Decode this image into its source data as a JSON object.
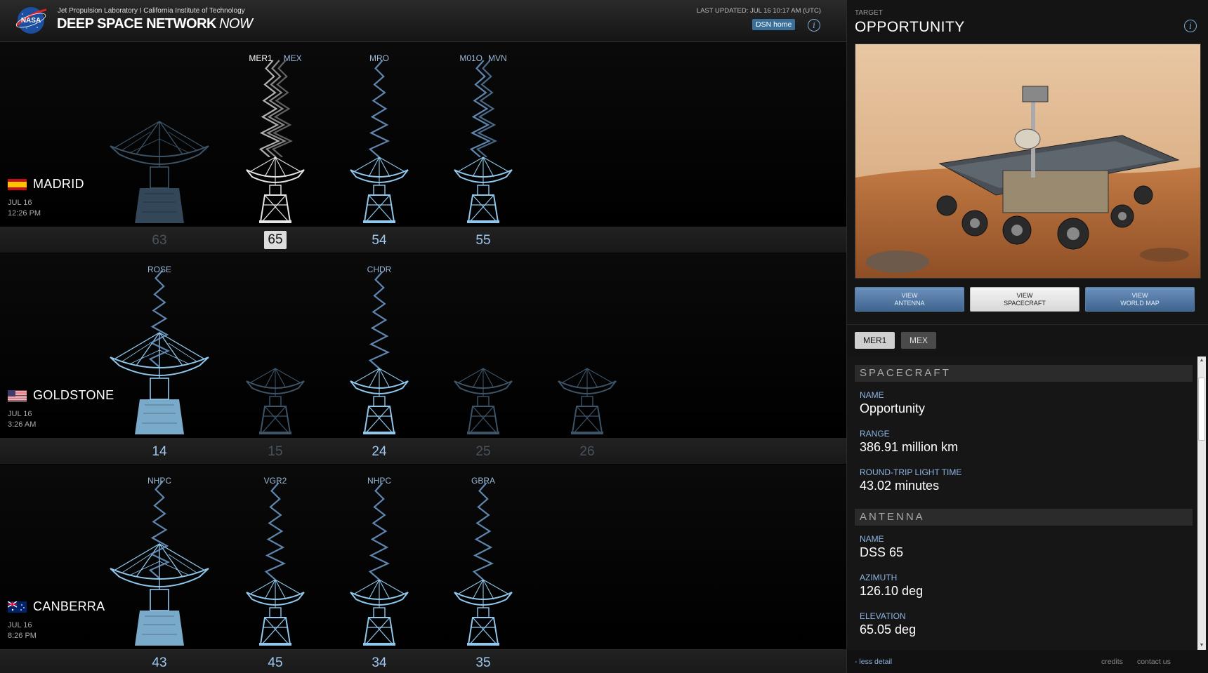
{
  "header": {
    "org_line": "Jet Propulsion Laboratory I California Institute of Technology",
    "title_main": "DEEP SPACE NETWORK",
    "title_now": "NOW",
    "last_updated": "LAST UPDATED: JUL 16 10:17 AM (UTC)",
    "dsn_home": "DSN home",
    "info_glyph": "i"
  },
  "colors": {
    "accent_blue": "#9ec8f0",
    "dish_blue": "#8fc8ec",
    "dish_dim": "#3c5468",
    "dish_white": "#e6e6e6"
  },
  "complexes": [
    {
      "name": "MADRID",
      "date": "JUL 16",
      "time": "12:26 PM",
      "flag": "spain-flag-icon",
      "dishes": [
        {
          "number": "63",
          "state": "dim",
          "size": "large",
          "targets": []
        },
        {
          "number": "65",
          "state": "selected",
          "size": "small",
          "targets": [
            "MER1",
            "MEX"
          ]
        },
        {
          "number": "54",
          "state": "active",
          "size": "small",
          "targets": [
            "MRO"
          ]
        },
        {
          "number": "55",
          "state": "active",
          "size": "small",
          "targets": [
            "M01O",
            "MVN"
          ]
        }
      ]
    },
    {
      "name": "GOLDSTONE",
      "date": "JUL 16",
      "time": "3:26 AM",
      "flag": "usa-flag-icon",
      "dishes": [
        {
          "number": "14",
          "state": "active",
          "size": "large",
          "targets": [
            "ROSE"
          ]
        },
        {
          "number": "15",
          "state": "dim",
          "size": "small",
          "targets": []
        },
        {
          "number": "24",
          "state": "active",
          "size": "small",
          "targets": [
            "CHDR"
          ]
        },
        {
          "number": "25",
          "state": "dim",
          "size": "small",
          "targets": []
        },
        {
          "number": "26",
          "state": "dim",
          "size": "small",
          "targets": []
        }
      ]
    },
    {
      "name": "CANBERRA",
      "date": "JUL 16",
      "time": "8:26 PM",
      "flag": "australia-flag-icon",
      "dishes": [
        {
          "number": "43",
          "state": "active",
          "size": "large",
          "targets": [
            "NHPC"
          ]
        },
        {
          "number": "45",
          "state": "active",
          "size": "small",
          "targets": [
            "VGR2"
          ]
        },
        {
          "number": "34",
          "state": "active",
          "size": "small",
          "targets": [
            "NHPC"
          ]
        },
        {
          "number": "35",
          "state": "active",
          "size": "small",
          "targets": [
            "GBRA"
          ]
        }
      ]
    }
  ],
  "panel": {
    "target_caption": "TARGET",
    "target_name": "OPPORTUNITY",
    "info_glyph": "i",
    "view_buttons": [
      {
        "line1": "VIEW",
        "line2": "ANTENNA",
        "active": false
      },
      {
        "line1": "VIEW",
        "line2": "SPACECRAFT",
        "active": true
      },
      {
        "line1": "VIEW",
        "line2": "WORLD MAP",
        "active": false
      }
    ],
    "tabs": [
      {
        "label": "MER1",
        "active": true
      },
      {
        "label": "MEX",
        "active": false
      }
    ],
    "spacecraft": {
      "heading": "SPACECRAFT",
      "name_label": "NAME",
      "name_value": "Opportunity",
      "range_label": "RANGE",
      "range_value": "386.91 million km",
      "rtlt_label": "ROUND-TRIP LIGHT TIME",
      "rtlt_value": "43.02 minutes"
    },
    "antenna": {
      "heading": "ANTENNA",
      "name_label": "NAME",
      "name_value": "DSS 65",
      "azimuth_label": "AZIMUTH",
      "azimuth_value": "126.10 deg",
      "elevation_label": "ELEVATION",
      "elevation_value": "65.05 deg"
    },
    "footer": {
      "less_detail": "- less detail",
      "credits": "credits",
      "contact": "contact us"
    }
  }
}
